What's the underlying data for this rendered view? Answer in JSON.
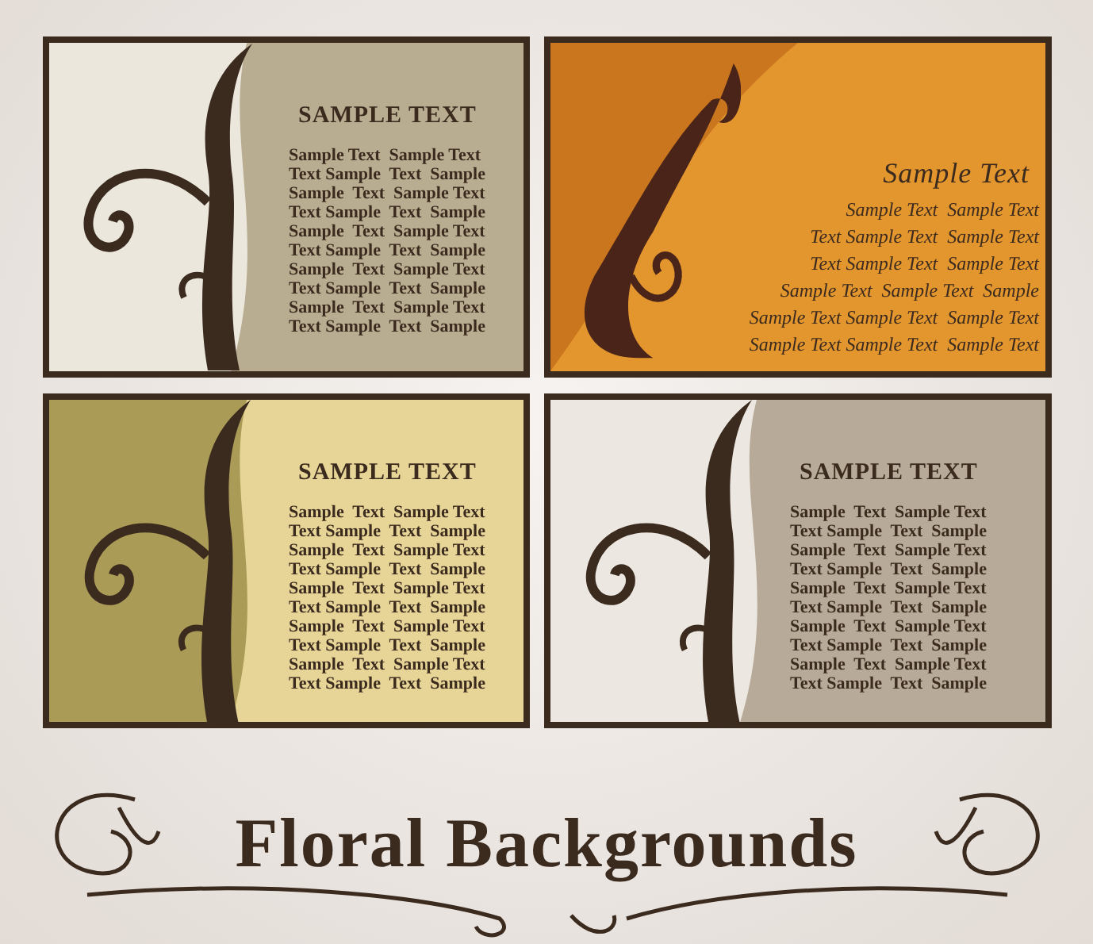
{
  "cards": [
    {
      "kind": "blackletter",
      "color": "#b9ad91",
      "title": "SAMPLE TEXT",
      "lines": [
        "Sample Text  Sample Text",
        "Text Sample  Text  Sample",
        "Sample  Text  Sample Text",
        "Text Sample  Text  Sample",
        "Sample  Text  Sample Text",
        "Text Sample  Text  Sample",
        "Sample  Text  Sample Text",
        "Text Sample  Text  Sample",
        "Sample  Text  Sample Text",
        "Text Sample  Text  Sample"
      ]
    },
    {
      "kind": "script",
      "color": "#e3962e",
      "title": "Sample Text",
      "lines": [
        "Sample Text  Sample Text",
        "Text Sample Text  Sample Text",
        "Text Sample Text  Sample Text",
        "Sample Text  Sample Text  Sample",
        "Sample Text Sample Text  Sample Text",
        "Sample Text Sample Text  Sample Text"
      ]
    },
    {
      "kind": "blackletter",
      "color": "#e6d597",
      "title": "SAMPLE TEXT",
      "lines": [
        "Sample  Text  Sample Text",
        "Text Sample  Text  Sample",
        "Sample  Text  Sample Text",
        "Text Sample  Text  Sample",
        "Sample  Text  Sample Text",
        "Text Sample  Text  Sample",
        "Sample  Text  Sample Text",
        "Text Sample  Text  Sample",
        "Sample  Text  Sample Text",
        "Text Sample  Text  Sample"
      ]
    },
    {
      "kind": "blackletter",
      "color": "#b7aa98",
      "title": "SAMPLE TEXT",
      "lines": [
        "Sample  Text  Sample Text",
        "Text Sample  Text  Sample",
        "Sample  Text  Sample Text",
        "Text Sample  Text  Sample",
        "Sample  Text  Sample Text",
        "Text Sample  Text  Sample",
        "Sample  Text  Sample Text",
        "Text Sample  Text  Sample",
        "Sample  Text  Sample Text",
        "Text Sample  Text  Sample"
      ]
    }
  ],
  "heading": "Floral Backgrounds"
}
